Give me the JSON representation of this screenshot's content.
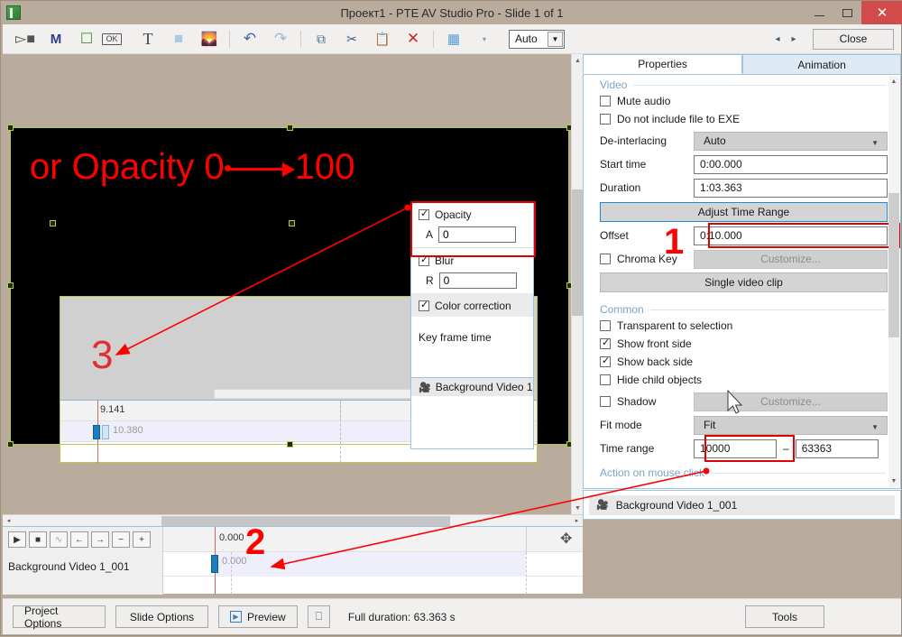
{
  "window": {
    "title": "Проект1 - PTE AV Studio Pro - Slide 1 of 1",
    "app_icon": "app-green-icon",
    "minimize": "minimize-icon",
    "maximize": "maximize-icon",
    "close": "✕"
  },
  "toolbar": {
    "items": [
      {
        "name": "video-clip-icon",
        "glyph": "✇"
      },
      {
        "name": "mask-m-icon",
        "glyph": "M"
      },
      {
        "name": "frame-icon",
        "glyph": "□"
      },
      {
        "name": "button-object-icon",
        "glyph": "OK"
      },
      {
        "name": "text-object-icon",
        "glyph": "T"
      },
      {
        "name": "rectangle-object-icon",
        "glyph": "■"
      },
      {
        "name": "image-object-icon",
        "glyph": "⛰"
      },
      {
        "name": "undo-icon",
        "glyph": "↶"
      },
      {
        "name": "redo-icon",
        "glyph": "↷"
      },
      {
        "name": "copy-icon",
        "glyph": "⧉"
      },
      {
        "name": "cut-icon",
        "glyph": "✂"
      },
      {
        "name": "paste-icon",
        "glyph": "Ὄb"
      },
      {
        "name": "delete-icon",
        "glyph": "✕"
      },
      {
        "name": "grid-icon",
        "glyph": "▦"
      },
      {
        "name": "grid-dropdown-icon",
        "glyph": "▾"
      }
    ],
    "zoom_value": "Auto",
    "prev_slide": "◂",
    "next_slide": "▸",
    "close_label": "Close"
  },
  "stage": {
    "text_before": "or Opacity 0",
    "text_after": "100",
    "arrow": "opacity-transition-arrow"
  },
  "inner_panel": {
    "marker": "3",
    "timeline": {
      "top_time": "9.141",
      "row_time": "10.380",
      "move_icon": "move-handle-icon"
    }
  },
  "keyframe_panel": {
    "opacity": {
      "label": "Opacity",
      "checked": true,
      "field_label": "A",
      "value": "0"
    },
    "blur": {
      "label": "Blur",
      "checked": true,
      "field_label": "R",
      "value": "0"
    },
    "color_correction": {
      "label": "Color correction",
      "checked": true
    },
    "key_frame_time": "Key frame time",
    "object_item": "Background Video 1"
  },
  "bottom_timeline": {
    "buttons": [
      {
        "name": "play-button",
        "glyph": "▶"
      },
      {
        "name": "stop-button",
        "glyph": "■"
      },
      {
        "name": "waveform-button",
        "glyph": "∿"
      },
      {
        "name": "prev-keyframe-button",
        "glyph": "←"
      },
      {
        "name": "next-keyframe-button",
        "glyph": "→"
      },
      {
        "name": "zoom-out-button",
        "glyph": "−"
      },
      {
        "name": "zoom-in-button",
        "glyph": "+"
      }
    ],
    "track_name": "Background Video 1_001",
    "ruler_time": "0.000",
    "clip_time": "0.000",
    "scroll_left": "◂",
    "scroll_right": "▸",
    "move_icon": "move-handle-icon"
  },
  "properties": {
    "tabs": [
      {
        "label": "Properties",
        "active": true
      },
      {
        "label": "Animation",
        "active": false
      }
    ],
    "video_group": "Video",
    "mute_audio": {
      "label": "Mute audio",
      "checked": false
    },
    "no_exe": {
      "label": "Do not include file to EXE",
      "checked": false
    },
    "deinterlacing": {
      "label": "De-interlacing",
      "value": "Auto"
    },
    "start_time": {
      "label": "Start time",
      "value": "0:00.000"
    },
    "duration": {
      "label": "Duration",
      "value": "1:03.363"
    },
    "adjust_time_range": "Adjust Time Range",
    "offset": {
      "label": "Offset",
      "value": "0:10.000"
    },
    "chroma_key": {
      "label": "Chroma Key",
      "checked": false,
      "button": "Customize..."
    },
    "single_video_clip": "Single video clip",
    "common_group": "Common",
    "transparent_to_selection": {
      "label": "Transparent to selection",
      "checked": false
    },
    "show_front_side": {
      "label": "Show front side",
      "checked": true
    },
    "show_back_side": {
      "label": "Show back side",
      "checked": true
    },
    "hide_child_objects": {
      "label": "Hide child objects",
      "checked": false
    },
    "shadow": {
      "label": "Shadow",
      "checked": false,
      "button": "Customize..."
    },
    "fit_mode": {
      "label": "Fit mode",
      "value": "Fit"
    },
    "time_range": {
      "label": "Time range",
      "from": "10000",
      "separator": "–",
      "to": "63363"
    },
    "action_on_mouse_click": "Action on mouse click",
    "objects_list_item": "Background Video 1_001"
  },
  "status_bar": {
    "project_options": "Project Options",
    "slide_options": "Slide Options",
    "preview": "Preview",
    "fullscreen_icon": "fullscreen-preview-icon",
    "full_duration": "Full duration: 63.363 s",
    "tools": "Tools"
  },
  "annotations": {
    "one": "1",
    "two": "2",
    "three": "3"
  },
  "colors": {
    "annotation_red": "#ff0000",
    "highlight_box": "#e00000",
    "accent_blue": "#1e8bd6",
    "window_chrome": "#b9ac9c",
    "stage_bg": "#000000"
  }
}
